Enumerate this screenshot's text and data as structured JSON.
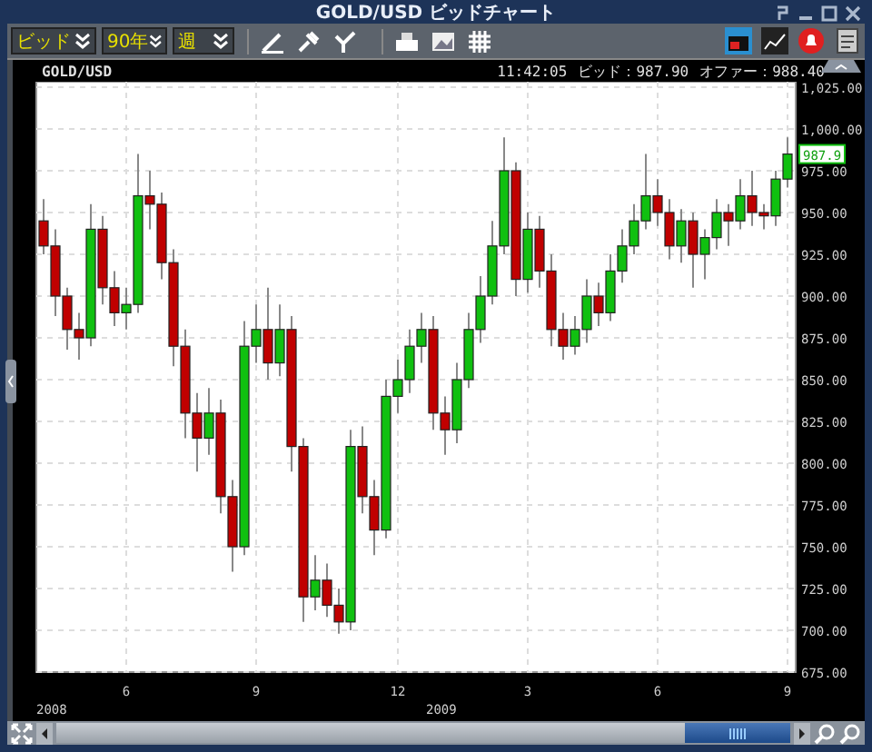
{
  "window": {
    "title": "GOLD/USD ビッドチャート"
  },
  "toolbar": {
    "dropdowns": [
      {
        "value": "ビッド"
      },
      {
        "value": "90年"
      },
      {
        "value": "週"
      }
    ]
  },
  "chart_header": {
    "symbol": "GOLD/USD",
    "time": "11:42:05",
    "bid": "ビッド：987.90",
    "offer": "オファー：988.40"
  },
  "price_tag": "987.9",
  "year_labels": [
    "2008",
    "2009"
  ],
  "chart_data": {
    "type": "candlestick",
    "grid": true,
    "ylim": [
      675,
      1025
    ],
    "yticks": [
      {
        "value": 1025,
        "label": "1,025.00"
      },
      {
        "value": 1000,
        "label": "1,000.00"
      },
      {
        "value": 975,
        "label": "975.00"
      },
      {
        "value": 950,
        "label": "950.00"
      },
      {
        "value": 925,
        "label": "925.00"
      },
      {
        "value": 900,
        "label": "900.00"
      },
      {
        "value": 875,
        "label": "875.00"
      },
      {
        "value": 850,
        "label": "850.00"
      },
      {
        "value": 825,
        "label": "825.00"
      },
      {
        "value": 800,
        "label": "800.00"
      },
      {
        "value": 775,
        "label": "775.00"
      },
      {
        "value": 750,
        "label": "750.00"
      },
      {
        "value": 725,
        "label": "725.00"
      },
      {
        "value": 700,
        "label": "700.00"
      },
      {
        "value": 675,
        "label": "675.00"
      }
    ],
    "categories": [
      null,
      null,
      null,
      null,
      null,
      null,
      null,
      "6",
      null,
      null,
      null,
      null,
      null,
      null,
      null,
      null,
      null,
      null,
      "9",
      null,
      null,
      null,
      null,
      null,
      null,
      null,
      null,
      null,
      null,
      null,
      "12",
      null,
      null,
      null,
      null,
      null,
      null,
      null,
      null,
      null,
      null,
      "3",
      null,
      null,
      null,
      null,
      null,
      null,
      null,
      null,
      null,
      null,
      "6",
      null,
      null,
      null,
      null,
      null,
      null,
      null,
      null,
      null,
      null,
      "9"
    ],
    "ohlc": [
      [
        945,
        958,
        925,
        930
      ],
      [
        930,
        940,
        888,
        900
      ],
      [
        900,
        905,
        868,
        880
      ],
      [
        880,
        890,
        862,
        875
      ],
      [
        875,
        955,
        870,
        940
      ],
      [
        940,
        948,
        895,
        905
      ],
      [
        905,
        915,
        882,
        890
      ],
      [
        890,
        905,
        880,
        895
      ],
      [
        895,
        985,
        890,
        960
      ],
      [
        960,
        975,
        940,
        955
      ],
      [
        955,
        962,
        910,
        920
      ],
      [
        920,
        928,
        858,
        870
      ],
      [
        870,
        880,
        815,
        830
      ],
      [
        830,
        842,
        795,
        815
      ],
      [
        815,
        845,
        805,
        830
      ],
      [
        830,
        838,
        770,
        780
      ],
      [
        780,
        790,
        735,
        750
      ],
      [
        750,
        885,
        745,
        870
      ],
      [
        870,
        895,
        860,
        880
      ],
      [
        880,
        905,
        850,
        860
      ],
      [
        860,
        895,
        852,
        880
      ],
      [
        880,
        888,
        795,
        810
      ],
      [
        810,
        815,
        705,
        720
      ],
      [
        720,
        745,
        712,
        730
      ],
      [
        730,
        740,
        708,
        715
      ],
      [
        715,
        725,
        698,
        705
      ],
      [
        705,
        820,
        700,
        810
      ],
      [
        810,
        822,
        770,
        780
      ],
      [
        780,
        790,
        745,
        760
      ],
      [
        760,
        850,
        755,
        840
      ],
      [
        840,
        862,
        830,
        850
      ],
      [
        850,
        880,
        842,
        870
      ],
      [
        870,
        890,
        860,
        880
      ],
      [
        880,
        888,
        820,
        830
      ],
      [
        830,
        840,
        805,
        820
      ],
      [
        820,
        860,
        812,
        850
      ],
      [
        850,
        890,
        845,
        880
      ],
      [
        880,
        912,
        872,
        900
      ],
      [
        900,
        945,
        895,
        930
      ],
      [
        930,
        995,
        925,
        975
      ],
      [
        975,
        980,
        900,
        910
      ],
      [
        910,
        950,
        902,
        940
      ],
      [
        940,
        948,
        905,
        915
      ],
      [
        915,
        925,
        870,
        880
      ],
      [
        880,
        890,
        862,
        870
      ],
      [
        870,
        888,
        865,
        880
      ],
      [
        880,
        910,
        872,
        900
      ],
      [
        900,
        908,
        882,
        890
      ],
      [
        890,
        925,
        885,
        915
      ],
      [
        915,
        940,
        908,
        930
      ],
      [
        930,
        955,
        925,
        945
      ],
      [
        945,
        985,
        940,
        960
      ],
      [
        960,
        970,
        942,
        950
      ],
      [
        950,
        958,
        922,
        930
      ],
      [
        930,
        952,
        920,
        945
      ],
      [
        945,
        950,
        905,
        925
      ],
      [
        925,
        940,
        910,
        935
      ],
      [
        935,
        958,
        928,
        950
      ],
      [
        950,
        955,
        930,
        945
      ],
      [
        945,
        970,
        940,
        960
      ],
      [
        960,
        975,
        942,
        950
      ],
      [
        950,
        955,
        940,
        948
      ],
      [
        948,
        975,
        942,
        970
      ],
      [
        970,
        995,
        965,
        985
      ]
    ]
  }
}
